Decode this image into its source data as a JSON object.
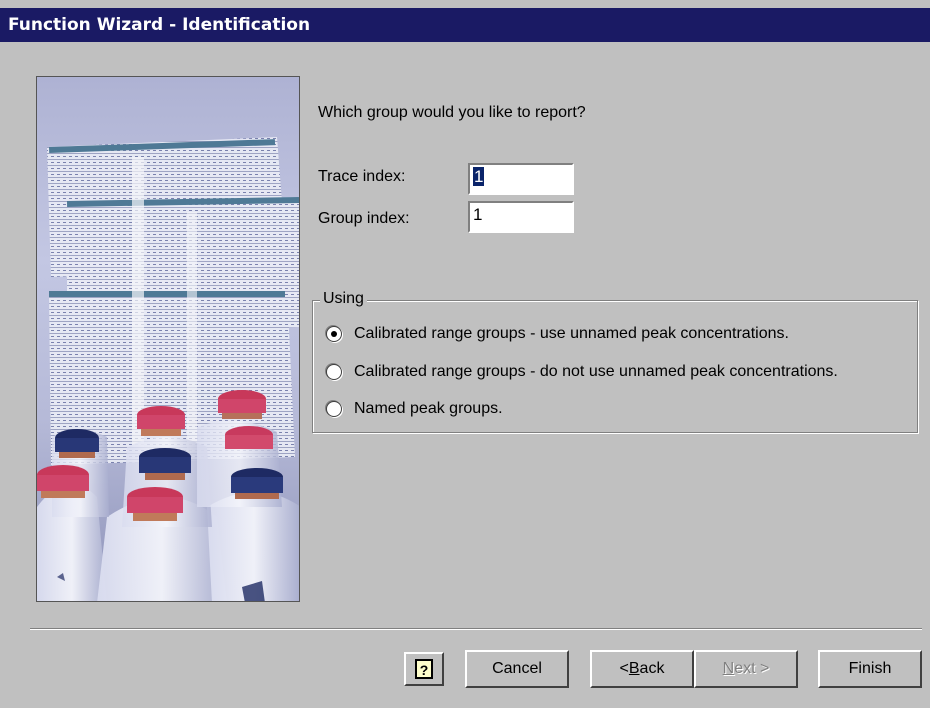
{
  "window": {
    "title": "Function Wizard - Identification"
  },
  "main": {
    "prompt": "Which group would you like to report?",
    "trace_index": {
      "label": "Trace index:",
      "value": "1"
    },
    "group_index": {
      "label": "Group index:",
      "value": "1"
    },
    "using": {
      "legend": "Using",
      "options": [
        {
          "label": "Calibrated range groups - use unnamed peak concentrations.",
          "selected": true
        },
        {
          "label": "Calibrated range groups - do not use unnamed peak concentrations.",
          "selected": false
        },
        {
          "label": "Named peak groups.",
          "selected": false
        }
      ]
    }
  },
  "buttons": {
    "help_icon": "help-icon",
    "cancel": "Cancel",
    "back_prefix": "< ",
    "back_hotkey": "B",
    "back_rest": "ack",
    "next_hotkey": "N",
    "next_rest": "ext >",
    "finish": "Finish"
  },
  "colors": {
    "title_bar": "#1a1a64",
    "face": "#c0c0c0",
    "selection": "#0a246a"
  }
}
